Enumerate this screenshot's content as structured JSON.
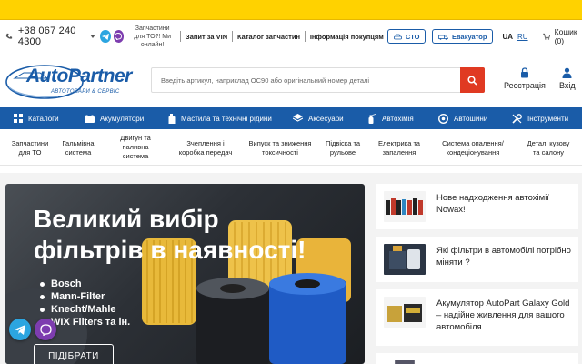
{
  "contacts": {
    "phone": "+38 067 240 4300",
    "question": "Запчастини для ТО?! Ми онлайн!",
    "link_vin": "Запит за VIN",
    "link_catalog": "Каталог запчастин",
    "link_info": "Інформація покупцям",
    "btn_sto": "СТО",
    "btn_evac": "Евакуатор",
    "lang_active": "UA",
    "lang_other": "RU",
    "cart": "Кошик (0)"
  },
  "header": {
    "logo_main": "AutoPartner",
    "logo_sub": "АВТОТОВАРИ & СЕРВІС",
    "search_placeholder": "Введіть артикул, наприклад OC90 або оригінальний номер деталі",
    "register": "Реєстрація",
    "login": "Вхід"
  },
  "catnav": [
    {
      "label": "Каталоги",
      "icon": "grid-icon"
    },
    {
      "label": "Акумулятори",
      "icon": "battery-icon"
    },
    {
      "label": "Мастила та технічні рідини",
      "icon": "oil-bottle-icon"
    },
    {
      "label": "Аксесуари",
      "icon": "layers-icon"
    },
    {
      "label": "Автохімія",
      "icon": "spray-icon"
    },
    {
      "label": "Автошини",
      "icon": "tire-icon"
    },
    {
      "label": "Інструменти",
      "icon": "tools-icon"
    }
  ],
  "subnav": [
    {
      "line1": "Запчастини",
      "line2": "для ТО",
      "line3": ""
    },
    {
      "line1": "Гальмівна",
      "line2": "система",
      "line3": ""
    },
    {
      "line1": "Двигун та",
      "line2": "паливна",
      "line3": "система"
    },
    {
      "line1": "Зчеплення і",
      "line2": "коробка передач",
      "line3": ""
    },
    {
      "line1": "Випуск та зниження",
      "line2": "токсичності",
      "line3": ""
    },
    {
      "line1": "Підвіска та",
      "line2": "рульове",
      "line3": ""
    },
    {
      "line1": "Електрика та",
      "line2": "запалення",
      "line3": ""
    },
    {
      "line1": "Система опалення/",
      "line2": "кондеціонування",
      "line3": ""
    },
    {
      "line1": "Деталі кузову",
      "line2": "та салону",
      "line3": ""
    }
  ],
  "banner": {
    "title": "Великий вибір фільтрів в наявності!",
    "brands": [
      "Bosch",
      "Mann-Filter",
      "Knecht/Mahle",
      "WIX Filters та ін."
    ],
    "button": "ПІДІБРАТИ"
  },
  "news": [
    {
      "title": "Нове надходження автохімії Nowax!",
      "icon": "chemistry-bottles-thumb"
    },
    {
      "title": "Які фільтри в автомобілі потрібно міняти ?",
      "icon": "engine-filter-thumb"
    },
    {
      "title": "Акумулятор AutoPart Galaxy Gold – надійне живлення для вашого автомобіля.",
      "icon": "battery-thumb"
    }
  ],
  "colors": {
    "yellow": "#ffd200",
    "blue": "#1a5ca8",
    "red": "#e03a22"
  }
}
